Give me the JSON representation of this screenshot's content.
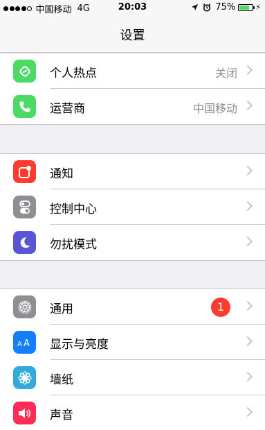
{
  "status_bar": {
    "carrier": "中国移动",
    "network": "4G",
    "time": "20:03",
    "battery_percent": "75%",
    "battery_level": 0.75,
    "signal_bars_filled": 4,
    "signal_bars_total": 5,
    "icons": [
      "signal-icon",
      "location-arrow-icon",
      "alarm-icon",
      "battery-icon",
      "charging-bolt-icon"
    ]
  },
  "nav": {
    "title": "设置"
  },
  "groups": [
    {
      "items": [
        {
          "label": "个人热点",
          "value": "关闭",
          "icon": "hotspot-icon",
          "color": "#4cd964"
        },
        {
          "label": "运营商",
          "value": "中国移动",
          "icon": "phone-icon",
          "color": "#4cd964"
        }
      ]
    },
    {
      "items": [
        {
          "label": "通知",
          "icon": "notifications-icon",
          "color": "#ff3b30"
        },
        {
          "label": "控制中心",
          "icon": "control-center-icon",
          "color": "#8e8e93"
        },
        {
          "label": "勿扰模式",
          "icon": "moon-icon",
          "color": "#5856d6"
        }
      ]
    },
    {
      "items": [
        {
          "label": "通用",
          "badge": "1",
          "icon": "gear-icon",
          "color": "#8e8e93"
        },
        {
          "label": "显示与亮度",
          "icon": "display-aa-icon",
          "color": "#147efb"
        },
        {
          "label": "墙纸",
          "icon": "wallpaper-flower-icon",
          "color": "#34aadc"
        },
        {
          "label": "声音",
          "icon": "speaker-icon",
          "color": "#ff2d55"
        }
      ]
    }
  ]
}
